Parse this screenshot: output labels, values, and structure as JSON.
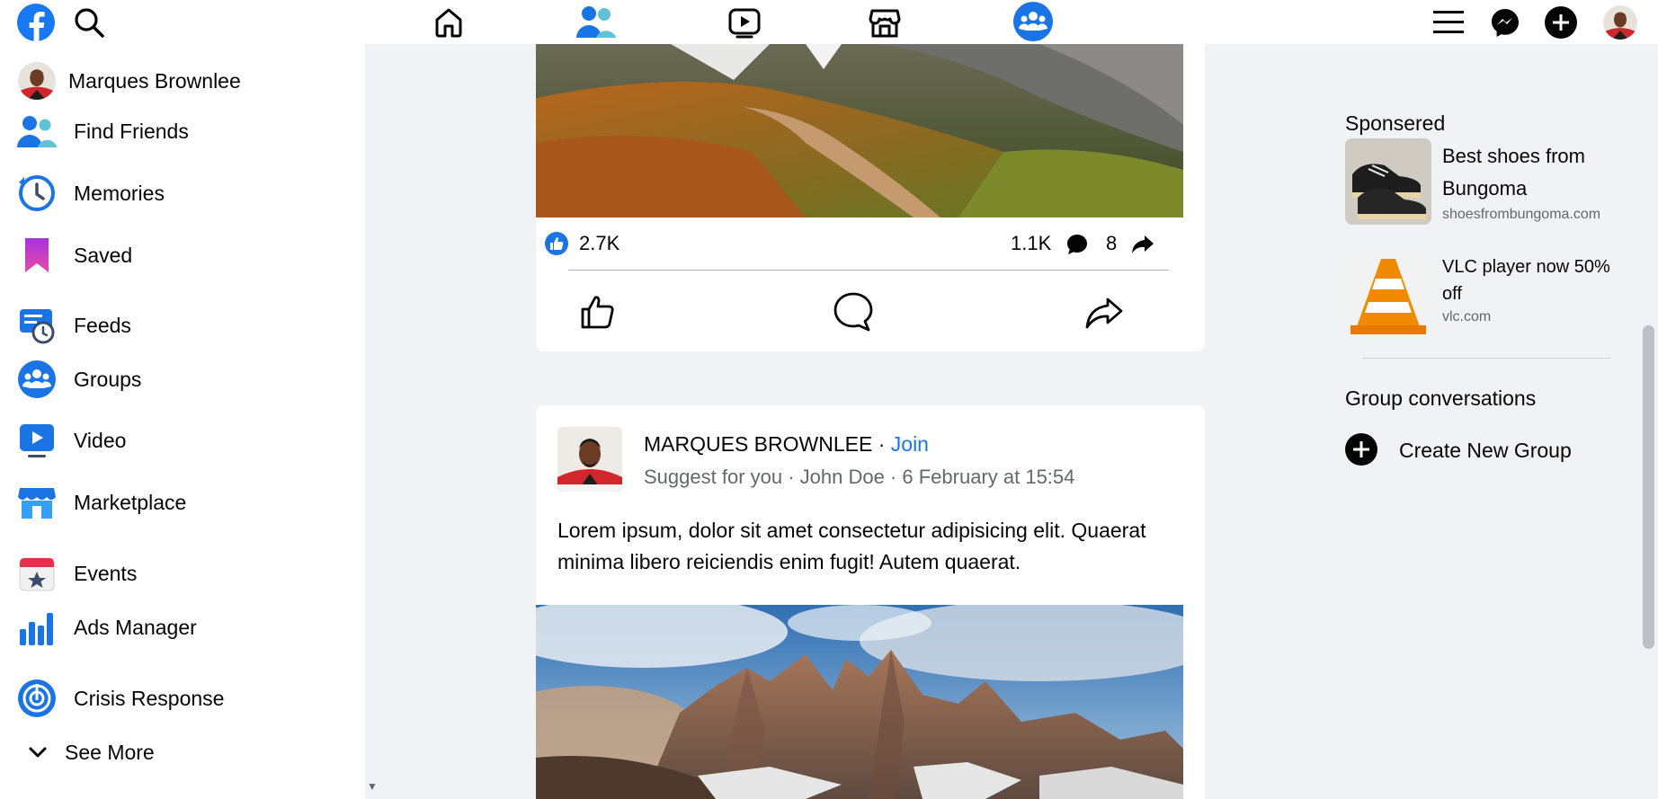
{
  "topbar": {
    "logo_icon": "facebook-logo-icon",
    "search_icon": "search-icon",
    "nav": [
      "home-icon",
      "friends-icon",
      "watch-icon",
      "marketplace-icon",
      "groups-icon"
    ],
    "right": [
      "menu-icon",
      "messenger-icon",
      "create-icon",
      "profile-avatar"
    ],
    "active_nav": "groups-icon",
    "brand_color": "#1877f2"
  },
  "sidebar": {
    "profile_name": "Marques Brownlee",
    "items": [
      {
        "label": "Find Friends",
        "icon": "find-friends-icon"
      },
      {
        "label": "Memories",
        "icon": "memories-icon"
      },
      {
        "label": "Saved",
        "icon": "saved-icon"
      },
      {
        "label": "Feeds",
        "icon": "feeds-icon"
      },
      {
        "label": "Groups",
        "icon": "groups-icon"
      },
      {
        "label": "Video",
        "icon": "video-icon"
      },
      {
        "label": "Marketplace",
        "icon": "marketplace-icon"
      },
      {
        "label": "Events",
        "icon": "events-icon"
      },
      {
        "label": "Ads Manager",
        "icon": "ads-manager-icon"
      },
      {
        "label": "Crisis Response",
        "icon": "crisis-response-icon"
      }
    ],
    "see_more": "See More"
  },
  "post1": {
    "likes": "2.7K",
    "comments": "1.1K",
    "shares": "8",
    "actions": [
      "like-button",
      "comment-button",
      "share-button"
    ]
  },
  "post2": {
    "author": "MARQUES BROWNLEE",
    "separator": " · ",
    "join": "Join",
    "meta": "Suggest for you · John Doe · 6 February at 15:54",
    "text": "Lorem ipsum, dolor sit amet consectetur adipisicing elit. Quaerat minima libero reiciendis enim fugit! Autem quaerat."
  },
  "right": {
    "sponsored_heading": "Sponsered",
    "ads": [
      {
        "title": "Best shoes from Bungoma",
        "domain": "shoesfrombungoma.com"
      },
      {
        "title": "VLC player now 50% off",
        "domain": "vlc.com"
      }
    ],
    "group_heading": "Group conversations",
    "create_group": "Create New Group"
  }
}
